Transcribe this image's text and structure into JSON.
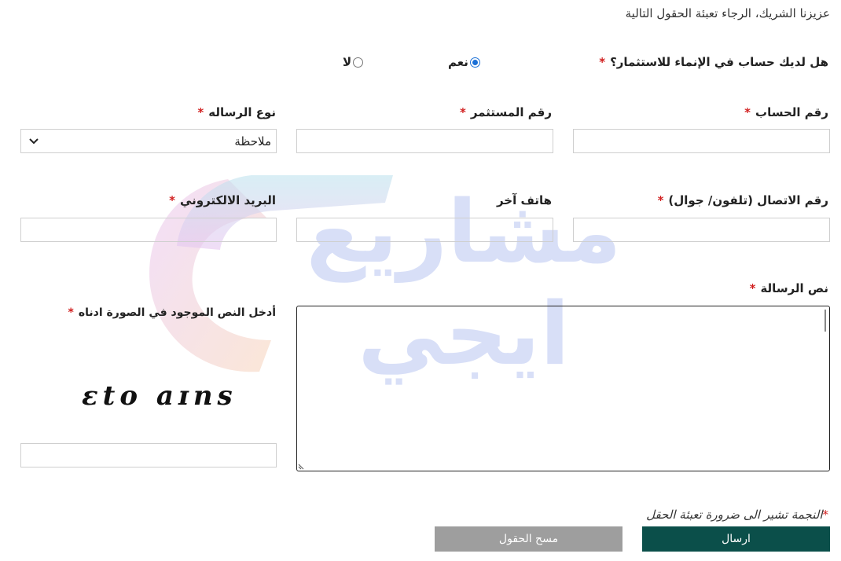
{
  "intro_text": "عزيزنا الشريك، الرجاء تعبئة الحقول التالية",
  "has_account": {
    "label": "هل لديك حساب في الإنماء للاستثمار؟",
    "yes_label": "نعم",
    "no_label": "لا",
    "selected": "نعم"
  },
  "fields": {
    "account_number": {
      "label": "رقم الحساب",
      "value": ""
    },
    "investor_number": {
      "label": "رقم المستثمر",
      "value": ""
    },
    "message_type": {
      "label": "نوع الرساله",
      "value": "ملاحظة"
    },
    "contact_number": {
      "label": "رقم الاتصال (تلفون/ جوال)",
      "value": ""
    },
    "other_phone": {
      "label": "هاتف آخر",
      "value": ""
    },
    "email": {
      "label": "البريد الالكتروني",
      "value": ""
    },
    "message_text": {
      "label": "نص الرسالة",
      "value": ""
    },
    "captcha_input": {
      "label": "أدخل النص الموجود في الصورة ادناه",
      "value": ""
    }
  },
  "captcha_image_text": "ɛto aɪns",
  "required_marker": "*",
  "note_text": "النجمة تشير الى ضرورة تعبئة الحقل",
  "buttons": {
    "send": "ارسال",
    "clear": "مسح الحقول"
  },
  "watermark": {
    "text_line1": "مشاريع",
    "text_line2": "ايجي"
  },
  "colors": {
    "required": "#d11f1f",
    "send_button": "#0b4f4a",
    "clear_button": "#9e9e9e",
    "radio_accent": "#1a6fd6"
  }
}
